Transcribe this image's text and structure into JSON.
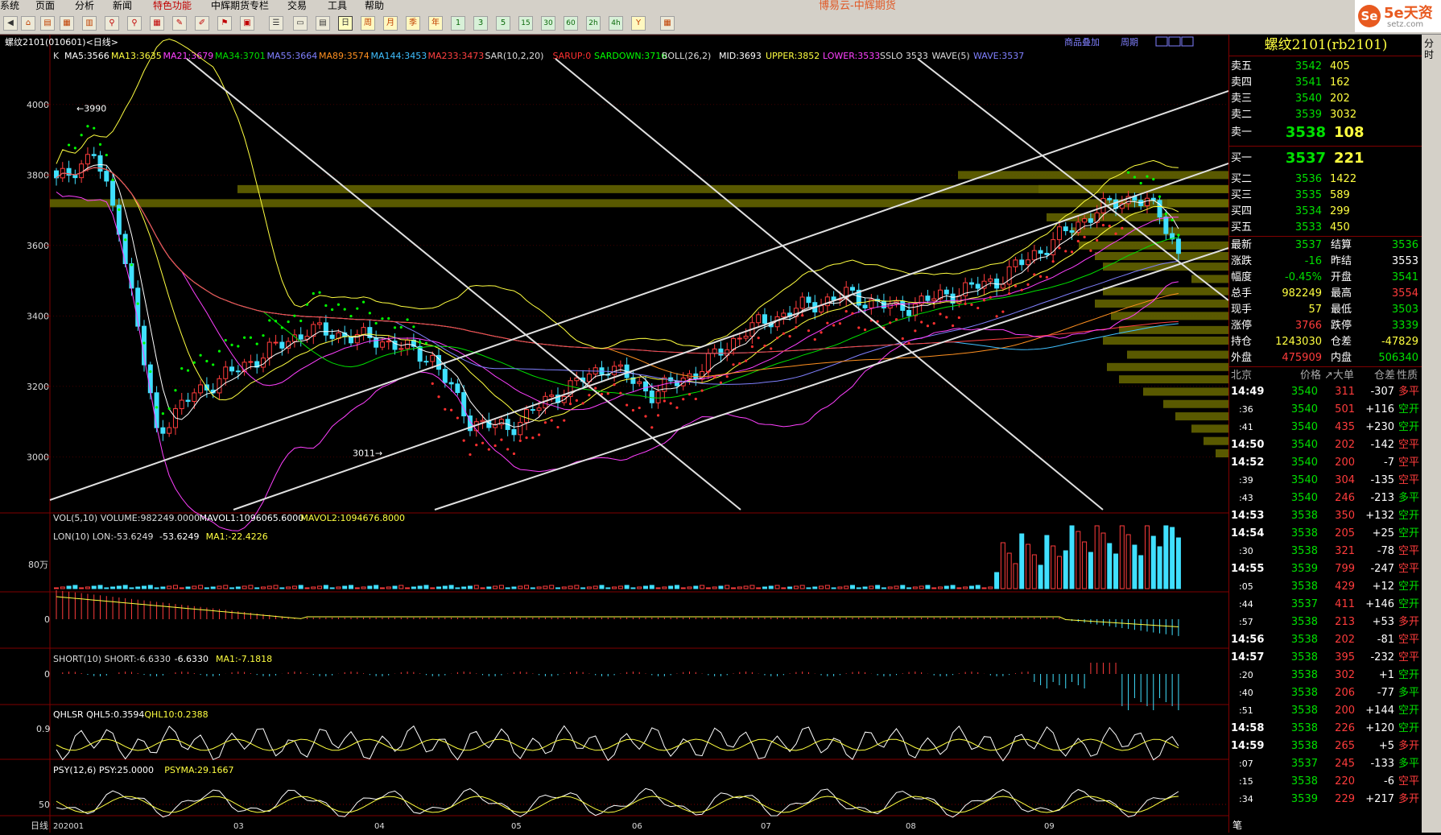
{
  "app_title": "博易云-中辉期货",
  "menu": [
    "系统",
    "页面",
    "分析",
    "新闻",
    "特色功能",
    "中辉期货专栏",
    "交易",
    "工具",
    "帮助"
  ],
  "toolbar": {
    "periods": [
      "日",
      "周",
      "月",
      "季",
      "年",
      "1",
      "3",
      "5",
      "15",
      "30",
      "60",
      "2h",
      "4h",
      "Y"
    ],
    "right_labels": [
      "商品叠加",
      "周期"
    ]
  },
  "logo": {
    "mark": "Se",
    "name": "5e天资",
    "url": "setz.com"
  },
  "chart": {
    "title": "螺纹2101(010601)<日线>",
    "main_legend_prefix": "K",
    "main_legend": [
      {
        "text": "MA5:3566",
        "color": "#ffffff"
      },
      {
        "text": "MA13:3635",
        "color": "#ffff40"
      },
      {
        "text": "MA21:3679",
        "color": "#ff40ff"
      },
      {
        "text": "MA34:3701",
        "color": "#00e000"
      },
      {
        "text": "MA55:3664",
        "color": "#8080ff"
      },
      {
        "text": "MA89:3574",
        "color": "#ff9020"
      },
      {
        "text": "MA144:3453",
        "color": "#40c0ff"
      },
      {
        "text": "MA233:3473",
        "color": "#ff4040"
      },
      {
        "text": "SAR(10,2,20)",
        "color": "#dddddd"
      },
      {
        "text": "SARUP:0",
        "color": "#ff3030"
      },
      {
        "text": "SARDOWN:3716",
        "color": "#00ff00"
      },
      {
        "text": "BOLL(26,2)",
        "color": "#dddddd"
      },
      {
        "text": "MID:3693",
        "color": "#ffffff"
      },
      {
        "text": "UPPER:3852",
        "color": "#ffff40"
      },
      {
        "text": "LOWER:3533",
        "color": "#ff40ff"
      },
      {
        "text": "SSLO 3533",
        "color": "#dddddd"
      },
      {
        "text": "WAVE(5)",
        "color": "#dddddd"
      },
      {
        "text": "WAVE:3537",
        "color": "#8080ff"
      }
    ],
    "y_ticks": [
      "4000",
      "3800",
      "3600",
      "3400",
      "3200",
      "3000"
    ],
    "y_values": [
      4000,
      3800,
      3600,
      3400,
      3200,
      3000
    ],
    "price_range": [
      2850,
      4130
    ],
    "high_label": "3990",
    "low_label": "3011",
    "vol_legend": [
      {
        "text": "VOL(5,10) VOLUME:982249.0000",
        "color": "#dddddd"
      },
      {
        "text": "MAVOL1:1096065.6000",
        "color": "#ffffff"
      },
      {
        "text": "MAVOL2:1094676.8000",
        "color": "#ffff40"
      }
    ],
    "vol_tick": "80万",
    "lon_legend": [
      {
        "text": "LON(10) LON:-53.6249",
        "color": "#dddddd"
      },
      {
        "text": "-53.6249",
        "color": "#ffffff"
      },
      {
        "text": "MA1:-22.4226",
        "color": "#ffff40"
      }
    ],
    "lon_tick": "0",
    "short_legend": [
      {
        "text": "SHORT(10) SHORT:-6.6330",
        "color": "#dddddd"
      },
      {
        "text": "-6.6330",
        "color": "#ffffff"
      },
      {
        "text": "MA1:-7.1818",
        "color": "#ffff40"
      }
    ],
    "short_tick": "0",
    "qhl_legend": [
      {
        "text": "QHLSR QHL5:0.3594",
        "color": "#ffffff"
      },
      {
        "text": "QHL10:0.2388",
        "color": "#ffff40"
      }
    ],
    "qhl_tick": "0.9",
    "psy_legend": [
      {
        "text": "PSY(12,6) PSY:25.0000",
        "color": "#ffffff"
      },
      {
        "text": "PSYMA:29.1667",
        "color": "#ffff40"
      }
    ],
    "psy_tick": "50",
    "x_prefix": "日线",
    "x_labels": [
      "202001",
      "03",
      "04",
      "05",
      "06",
      "07",
      "08",
      "09"
    ]
  },
  "quote": {
    "title": "螺纹2101(rb2101)",
    "asks": [
      {
        "label": "卖五",
        "price": "3542",
        "vol": "405"
      },
      {
        "label": "卖四",
        "price": "3541",
        "vol": "162"
      },
      {
        "label": "卖三",
        "price": "3540",
        "vol": "202"
      },
      {
        "label": "卖二",
        "price": "3539",
        "vol": "3032"
      },
      {
        "label": "卖一",
        "price": "3538",
        "vol": "108"
      }
    ],
    "bids": [
      {
        "label": "买一",
        "price": "3537",
        "vol": "221"
      },
      {
        "label": "买二",
        "price": "3536",
        "vol": "1422"
      },
      {
        "label": "买三",
        "price": "3535",
        "vol": "589"
      },
      {
        "label": "买四",
        "price": "3534",
        "vol": "299"
      },
      {
        "label": "买五",
        "price": "3533",
        "vol": "450"
      }
    ],
    "stats": [
      {
        "l1": "最新",
        "v1": "3537",
        "c1": "grn",
        "l2": "结算",
        "v2": "3536",
        "c2": "grn"
      },
      {
        "l1": "涨跌",
        "v1": "-16",
        "c1": "grn",
        "l2": "昨结",
        "v2": "3553",
        "c2": "wht"
      },
      {
        "l1": "幅度",
        "v1": "-0.45%",
        "c1": "grn",
        "l2": "开盘",
        "v2": "3541",
        "c2": "grn"
      },
      {
        "l1": "总手",
        "v1": "982249",
        "c1": "yel",
        "l2": "最高",
        "v2": "3554",
        "c2": "red"
      },
      {
        "l1": "现手",
        "v1": "57",
        "c1": "yel",
        "l2": "最低",
        "v2": "3503",
        "c2": "grn"
      },
      {
        "l1": "涨停",
        "v1": "3766",
        "c1": "red",
        "l2": "跌停",
        "v2": "3339",
        "c2": "grn"
      },
      {
        "l1": "持仓",
        "v1": "1243030",
        "c1": "yel",
        "l2": "仓差",
        "v2": "-47829",
        "c2": "yel"
      },
      {
        "l1": "外盘",
        "v1": "475909",
        "c1": "red",
        "l2": "内盘",
        "v2": "506340",
        "c2": "grn"
      }
    ],
    "tick_header": {
      "loc": "北京",
      "price": "价格",
      "vol": "↗大单",
      "diff": "仓差",
      "nature": "性质"
    },
    "ticks": [
      {
        "t": "14:49",
        "p": "3540",
        "v": "311",
        "d": "-307",
        "n": "多平",
        "nc": "red"
      },
      {
        "t": ":36",
        "p": "3540",
        "v": "501",
        "d": "+116",
        "n": "空开",
        "nc": "grn"
      },
      {
        "t": ":41",
        "p": "3540",
        "v": "435",
        "d": "+230",
        "n": "空开",
        "nc": "grn"
      },
      {
        "t": "14:50",
        "p": "3540",
        "v": "202",
        "d": "-142",
        "n": "空平",
        "nc": "red"
      },
      {
        "t": "14:52",
        "p": "3540",
        "v": "200",
        "d": "-7",
        "n": "空平",
        "nc": "red"
      },
      {
        "t": ":39",
        "p": "3540",
        "v": "304",
        "d": "-135",
        "n": "空平",
        "nc": "red"
      },
      {
        "t": ":43",
        "p": "3540",
        "v": "246",
        "d": "-213",
        "n": "多平",
        "nc": "grn"
      },
      {
        "t": "14:53",
        "p": "3538",
        "v": "350",
        "d": "+132",
        "n": "空开",
        "nc": "grn"
      },
      {
        "t": "14:54",
        "p": "3538",
        "v": "205",
        "d": "+25",
        "n": "空开",
        "nc": "grn"
      },
      {
        "t": ":30",
        "p": "3538",
        "v": "321",
        "d": "-78",
        "n": "空平",
        "nc": "red"
      },
      {
        "t": "14:55",
        "p": "3539",
        "v": "799",
        "d": "-247",
        "n": "空平",
        "nc": "red"
      },
      {
        "t": ":05",
        "p": "3538",
        "v": "429",
        "d": "+12",
        "n": "空开",
        "nc": "grn"
      },
      {
        "t": ":44",
        "p": "3537",
        "v": "411",
        "d": "+146",
        "n": "空开",
        "nc": "grn"
      },
      {
        "t": ":57",
        "p": "3538",
        "v": "213",
        "d": "+53",
        "n": "多开",
        "nc": "red"
      },
      {
        "t": "14:56",
        "p": "3538",
        "v": "202",
        "d": "-81",
        "n": "空平",
        "nc": "red"
      },
      {
        "t": "14:57",
        "p": "3538",
        "v": "395",
        "d": "-232",
        "n": "空平",
        "nc": "red"
      },
      {
        "t": ":20",
        "p": "3538",
        "v": "302",
        "d": "+1",
        "n": "空开",
        "nc": "grn"
      },
      {
        "t": ":40",
        "p": "3538",
        "v": "206",
        "d": "-77",
        "n": "多平",
        "nc": "grn"
      },
      {
        "t": ":51",
        "p": "3538",
        "v": "200",
        "d": "+144",
        "n": "空开",
        "nc": "grn"
      },
      {
        "t": "14:58",
        "p": "3538",
        "v": "226",
        "d": "+120",
        "n": "空开",
        "nc": "grn"
      },
      {
        "t": "14:59",
        "p": "3538",
        "v": "265",
        "d": "+5",
        "n": "多开",
        "nc": "red"
      },
      {
        "t": ":07",
        "p": "3537",
        "v": "245",
        "d": "-133",
        "n": "多平",
        "nc": "grn"
      },
      {
        "t": ":15",
        "p": "3538",
        "v": "220",
        "d": "-6",
        "n": "空平",
        "nc": "red"
      },
      {
        "t": ":34",
        "p": "3539",
        "v": "229",
        "d": "+217",
        "n": "多开",
        "nc": "red"
      }
    ],
    "footer_tab": "笔",
    "side_tab": "分时"
  }
}
